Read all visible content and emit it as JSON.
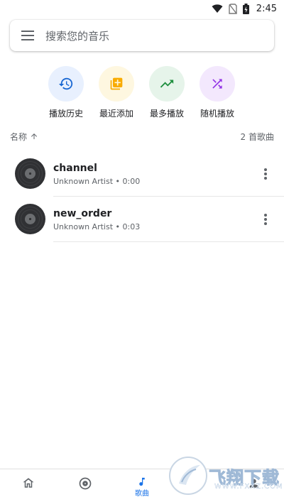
{
  "status_bar": {
    "time": "2:45",
    "icons": [
      "wifi-icon",
      "no-sim-icon",
      "battery-icon"
    ]
  },
  "search": {
    "placeholder": "搜索您的音乐",
    "menu_icon": "menu-icon"
  },
  "quick_actions": [
    {
      "label": "播放历史",
      "icon": "history-icon",
      "bg": "#e8f0fe",
      "color": "#1967d2"
    },
    {
      "label": "最近添加",
      "icon": "library-add-icon",
      "bg": "#fef7e0",
      "color": "#f9ab00"
    },
    {
      "label": "最多播放",
      "icon": "trending-up-icon",
      "bg": "#e6f4ea",
      "color": "#1e8e3e"
    },
    {
      "label": "随机播放",
      "icon": "shuffle-icon",
      "bg": "#f3e8fd",
      "color": "#9334e6"
    }
  ],
  "list_header": {
    "sort_label": "名称",
    "count": "2 首歌曲"
  },
  "songs": [
    {
      "title": "channel",
      "subtitle": "Unknown Artist • 0:00"
    },
    {
      "title": "new_order",
      "subtitle": "Unknown Artist • 0:03"
    }
  ],
  "bottom_nav": {
    "active_label": "歌曲",
    "accent": "#1a73e8"
  },
  "watermark": {
    "text": "飞翔下载",
    "sub": "WWW.FXXZ.COM"
  }
}
